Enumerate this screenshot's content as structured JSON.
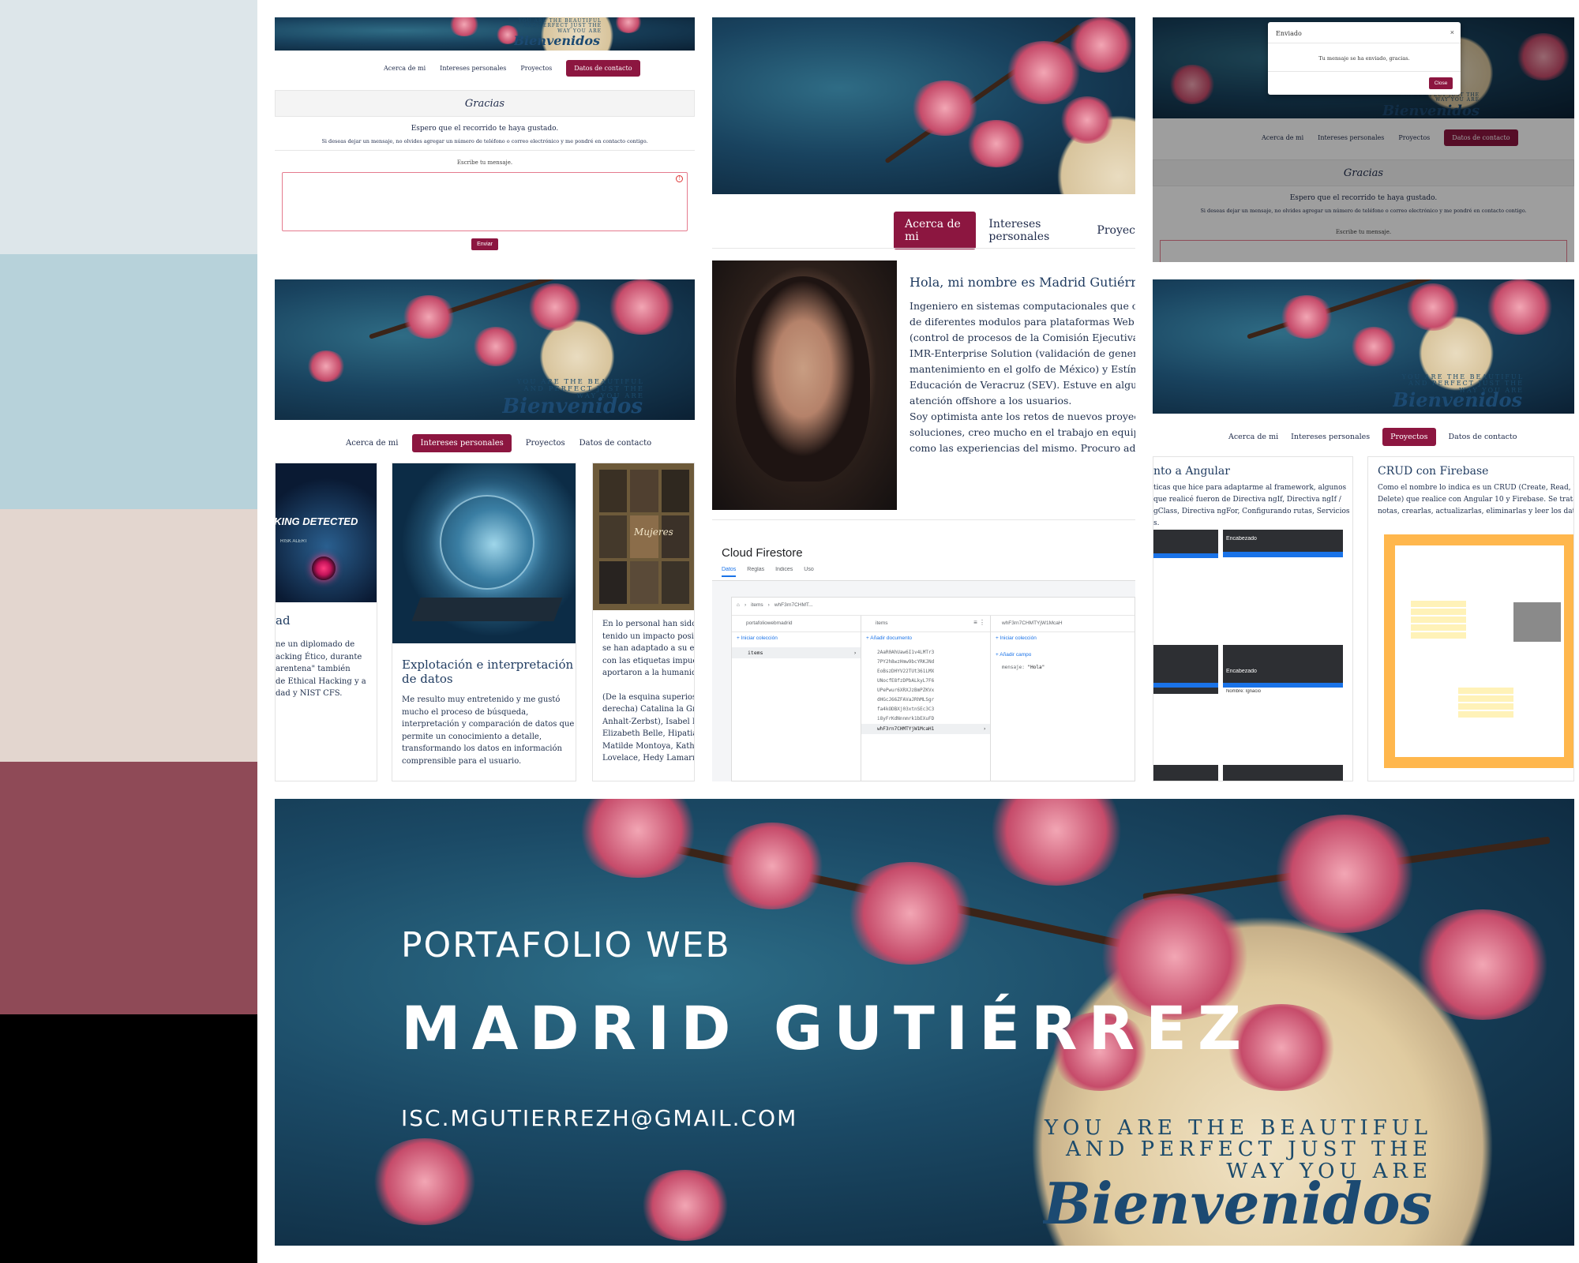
{
  "palette": {
    "swatches": [
      "#dde6ea",
      "#b7d2da",
      "#e3d6cf",
      "#8f4a57",
      "#000000"
    ],
    "accent": "#8c1640",
    "text": "#1e2a4a"
  },
  "banner_text": {
    "line1": "YOU ARE THE BEAUTIFUL",
    "line2": "AND PERFECT JUST THE",
    "line3": "WAY YOU ARE",
    "script": "Bienvenidos"
  },
  "nav": {
    "about": "Acerca de mi",
    "interests": "Intereses personales",
    "projects": "Proyectos",
    "contact": "Datos de contacto",
    "projects_cut": "Proyec"
  },
  "contact_panel": {
    "heading": "Gracias",
    "intro": "Espero que el recorrido te haya gustado.",
    "note": "Si deseas dejar un mensaje, no olvides agregar un número de teléfono o correo electrónico y me pondré en contacto contigo.",
    "label": "Escribe tu mensaje.",
    "send": "Enviar"
  },
  "modal": {
    "title": "Enviado",
    "message": "Tu mensaje se ha enviado, gracias.",
    "close": "Close"
  },
  "about": {
    "heading": "Hola, mi nombre es Madrid Gutiérrez I",
    "lines": [
      "Ingeniero en sistemas computacionales que cont",
      "de diferentes modulos para plataformas Web con",
      "(control de procesos de la Comisión Ejecutiva de",
      "IMR-Enterprise Solution (validación de generad",
      "mantenimiento en el golfo de México) y Estímulo",
      "Educación de Veracruz (SEV). Estuve en algunas",
      "atención offshore a los usuarios.",
      "Soy optimista ante los retos de nuevos proyectos",
      "soluciones, creo mucho en el trabajo en equipo, c",
      "como las experiencias del mismo. Procuro adapt"
    ]
  },
  "interest_cards": {
    "left": {
      "image_caption": "HACKING DETECTED",
      "image_sub": "RISK ALERT",
      "title_cut": "ad",
      "lines": [
        "ne un diplomado de",
        "acking Ético, durante",
        "arentena\" también",
        "de Ethical Hacking y a",
        "dad y NIST CFS."
      ]
    },
    "middle": {
      "title": "Explotación e interpretación de datos",
      "lines": [
        "Me resulto muy entretenido y me gustó",
        "mucho el proceso de búsqueda,",
        "interpretación y comparación de datos que",
        "permite un conocimiento a detalle,",
        "transformando los datos en información",
        "comprensible para el usuario."
      ]
    },
    "right": {
      "image_caption": "Mujeres",
      "lines": [
        "En lo personal han sido r",
        "tenido un impacto positi",
        "se han adaptado a su ent",
        "con las etiquetas impuest",
        "aportaron a la humanida",
        "",
        "(De la esquina superios iz",
        "derecha) Catalina la Gra",
        "Anhalt-Zerbst), Isabel I d",
        "Elizabeth Belle, Hipatia d",
        "Matilde Montoya, Kather",
        "Lovelace, Hedy Lamarr y"
      ]
    }
  },
  "firestore": {
    "title": "Cloud Firestore",
    "tabs": [
      "Datos",
      "Reglas",
      "Índices",
      "Uso"
    ],
    "breadcrumb": [
      "items",
      "whF3rn7CHMT..."
    ],
    "col1_header": "portafoliowebmadrid",
    "col1_action": "Iniciar colección",
    "col1_item": "items",
    "col2_header": "items",
    "col2_action": "Añadir documento",
    "doc_ids": [
      "2AaR0AhUaw6I1v4LMTr3",
      "7PY2h8wzHmw9bcYRKJNd",
      "EoBszDHYV22TUt361LMX",
      "UNocfE8fzDPbALkyL7F6",
      "UPePwur6XRXJzBmPZKVx",
      "dHGcJ66ZFAVaJRhMLSgr",
      "fa4kODBXj03xtnSEc3C3",
      "i8yFrKdNnnmrk1bEXuFD",
      "whF3rn7CHMTYjW1McaH1"
    ],
    "col3_header": "whF3rn7CHMTYjW1McaH",
    "col3_action": "Iniciar colección",
    "col3_field_action": "Añadir campo",
    "field_key": "mensaje",
    "field_value": "\"Hola\""
  },
  "projects": {
    "angular_title": "nto a Angular",
    "angular_lines": [
      "ticas que hice para adaptarme al framework, algunos",
      "que realicé fueron de Directiva ngIf, Directiva ngIf /",
      "gClass, Directiva ngFor, Configurando rutas, Servicios",
      "s."
    ],
    "firebase_title": "CRUD con Firebase",
    "firebase_lines": [
      "Como el nombre lo indica es un CRUD (Create, Read, U",
      "Delete) que realice con Angular 10 y Firebase. Se trata",
      "notas, crearlas, actualizarlas, eliminarlas y leer los dat"
    ],
    "mock_label": "Encabezado",
    "mock_label2": "Nombre: Ignacio"
  },
  "hero": {
    "subtitle": "PORTAFOLIO WEB",
    "name": "MADRID GUTIÉRREZ",
    "email": "ISC.MGUTIERREZH@GMAIL.COM"
  }
}
